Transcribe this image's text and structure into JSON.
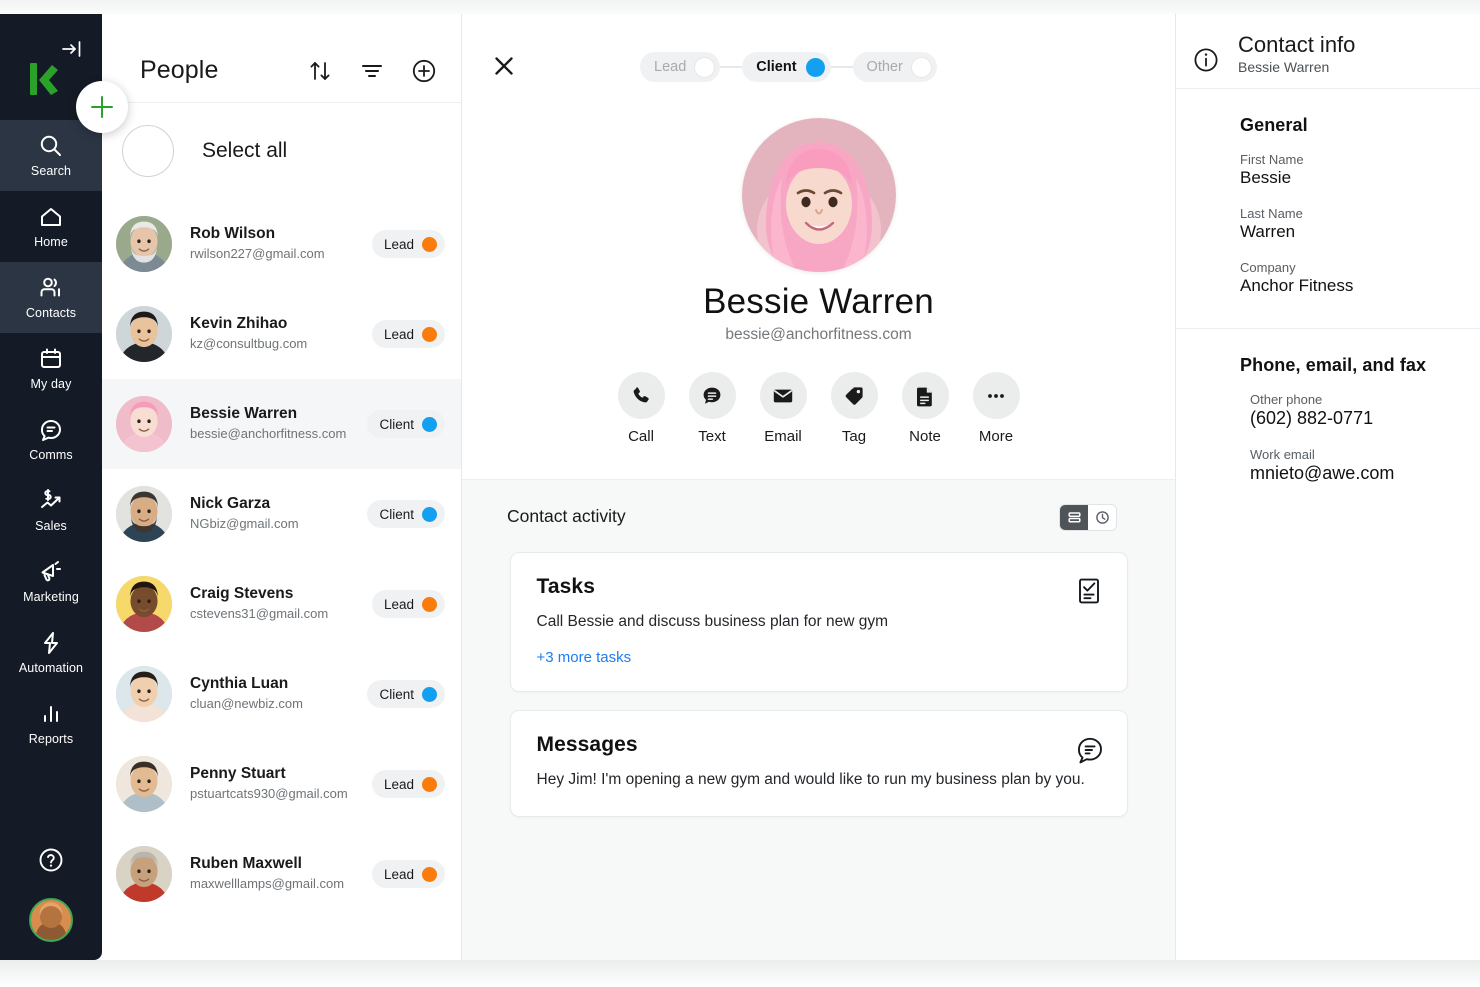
{
  "nav": {
    "collapse_icon": "collapse-sidebar-icon",
    "logo": "keap-logo",
    "add_label": "+",
    "items": [
      {
        "label": "Search",
        "icon": "search-icon",
        "active": false
      },
      {
        "label": "Home",
        "icon": "home-icon",
        "active": false
      },
      {
        "label": "Contacts",
        "icon": "contacts-icon",
        "active": true
      },
      {
        "label": "My day",
        "icon": "calendar-icon",
        "active": false
      },
      {
        "label": "Comms",
        "icon": "chat-icon",
        "active": false
      },
      {
        "label": "Sales",
        "icon": "sales-chart-icon",
        "active": false
      },
      {
        "label": "Marketing",
        "icon": "megaphone-icon",
        "active": false
      },
      {
        "label": "Automation",
        "icon": "lightning-bolt-icon",
        "active": false
      },
      {
        "label": "Reports",
        "icon": "bar-chart-icon",
        "active": false
      }
    ],
    "help_icon": "help-circle-icon",
    "user_avatar": "user-avatar"
  },
  "people": {
    "title": "People",
    "sort_icon": "sort-arrows-icon",
    "filter_icon": "filter-icon",
    "add_icon": "add-circle-icon",
    "select_all_label": "Select all",
    "contacts": [
      {
        "name": "Rob Wilson",
        "email": "rwilson227@gmail.com",
        "status": "Lead",
        "status_color": "#f97c0c",
        "selected": false,
        "avatar": "avatar-rob-wilson"
      },
      {
        "name": "Kevin Zhihao",
        "email": "kz@consultbug.com",
        "status": "Lead",
        "status_color": "#f97c0c",
        "selected": false,
        "avatar": "avatar-kevin-zhihao"
      },
      {
        "name": "Bessie Warren",
        "email": "bessie@anchorfitness.com",
        "status": "Client",
        "status_color": "#13a0f0",
        "selected": true,
        "avatar": "avatar-bessie-warren"
      },
      {
        "name": "Nick Garza",
        "email": "NGbiz@gmail.com",
        "status": "Client",
        "status_color": "#13a0f0",
        "selected": false,
        "avatar": "avatar-nick-garza"
      },
      {
        "name": "Craig Stevens",
        "email": "cstevens31@gmail.com",
        "status": "Lead",
        "status_color": "#f97c0c",
        "selected": false,
        "avatar": "avatar-craig-stevens"
      },
      {
        "name": "Cynthia Luan",
        "email": "cluan@newbiz.com",
        "status": "Client",
        "status_color": "#13a0f0",
        "selected": false,
        "avatar": "avatar-cynthia-luan"
      },
      {
        "name": "Penny Stuart",
        "email": "pstuartcats930@gmail.com",
        "status": "Lead",
        "status_color": "#f97c0c",
        "selected": false,
        "avatar": "avatar-penny-stuart"
      },
      {
        "name": "Ruben Maxwell",
        "email": "maxwelllamps@gmail.com",
        "status": "Lead",
        "status_color": "#f97c0c",
        "selected": false,
        "avatar": "avatar-ruben-maxwell"
      }
    ]
  },
  "detail": {
    "close_icon": "close-icon",
    "stages": [
      {
        "label": "Lead",
        "active": false
      },
      {
        "label": "Client",
        "active": true
      },
      {
        "label": "Other",
        "active": false
      }
    ],
    "active_stage_color": "#13a0f0",
    "contact_name": "Bessie Warren",
    "contact_email": "bessie@anchorfitness.com",
    "avatar": "avatar-bessie-warren-large",
    "quick_actions": [
      {
        "label": "Call",
        "icon": "phone-icon"
      },
      {
        "label": "Text",
        "icon": "message-bubble-icon"
      },
      {
        "label": "Email",
        "icon": "envelope-icon"
      },
      {
        "label": "Tag",
        "icon": "tag-icon"
      },
      {
        "label": "Note",
        "icon": "document-icon"
      },
      {
        "label": "More",
        "icon": "ellipsis-icon"
      }
    ],
    "activity": {
      "title": "Contact activity",
      "view_list_icon": "list-view-icon",
      "view_timeline_icon": "clock-view-icon",
      "active_view": "list",
      "cards": [
        {
          "title": "Tasks",
          "body": "Call Bessie and discuss business plan for new gym",
          "link": "+3 more tasks",
          "icon": "task-checklist-icon"
        },
        {
          "title": "Messages",
          "body": "Hey Jim! I'm opening a new gym and would like to run my business plan by you.",
          "link": null,
          "icon": "message-lines-icon"
        }
      ]
    }
  },
  "info": {
    "icon": "info-circle-icon",
    "title": "Contact info",
    "subtitle": "Bessie Warren",
    "sections": [
      {
        "heading": "General",
        "fields": [
          {
            "key": "First Name",
            "value": "Bessie"
          },
          {
            "key": "Last Name",
            "value": "Warren"
          },
          {
            "key": "Company",
            "value": "Anchor Fitness"
          }
        ]
      },
      {
        "heading": "Phone, email, and fax",
        "fields": [
          {
            "key": "Other phone",
            "value": "(602) 882-0771"
          },
          {
            "key": "Work email",
            "value": "mnieto@awe.com"
          }
        ]
      }
    ]
  }
}
